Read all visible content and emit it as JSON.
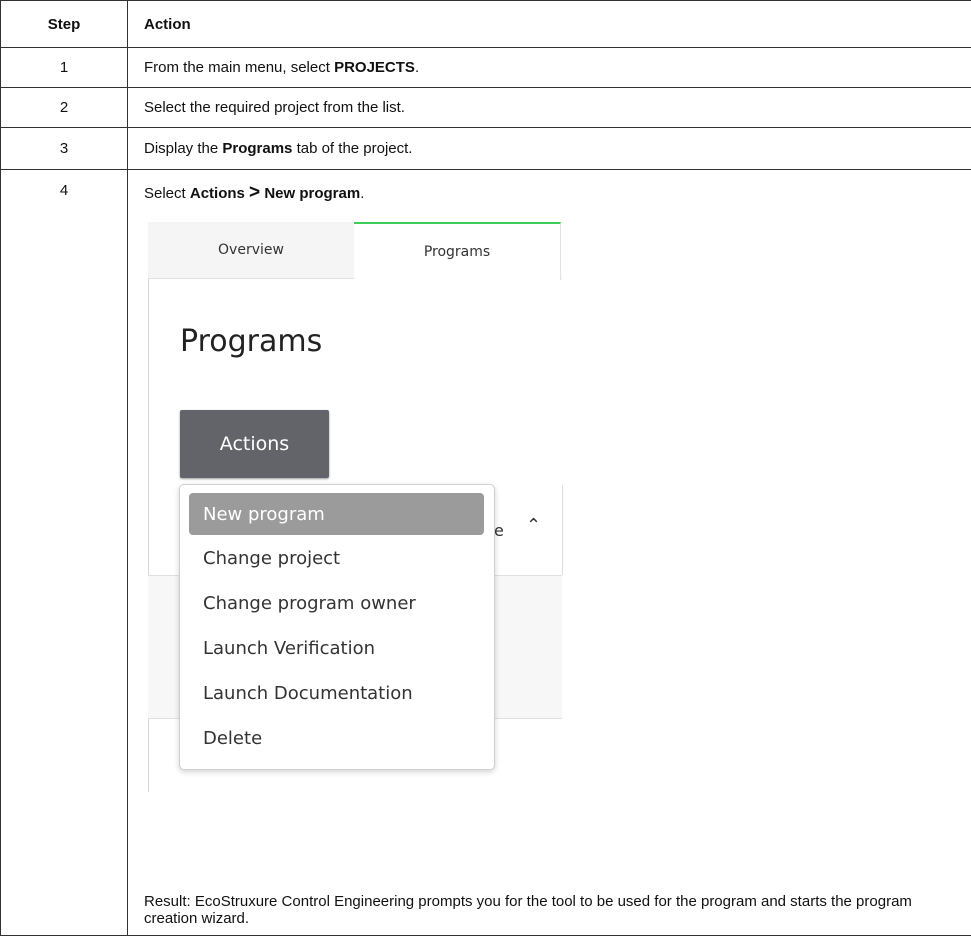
{
  "table": {
    "headers": {
      "step": "Step",
      "action": "Action"
    },
    "rows": [
      {
        "step": "1",
        "pre": "From the main menu, select ",
        "bold": "PROJECTS",
        "post": "."
      },
      {
        "step": "2",
        "text": "Select the required project from the list."
      },
      {
        "step": "3",
        "pre": "Display the ",
        "bold": "Programs",
        "post": " tab of the project."
      },
      {
        "step": "4",
        "pre": "Select ",
        "bold1": "Actions",
        "sep": ">",
        "bold2": "New program",
        "post": "."
      }
    ]
  },
  "screenshot": {
    "tabs": [
      "Overview",
      "Programs"
    ],
    "page_title": "Programs",
    "actions_button": "Actions",
    "sort_fragment": "e",
    "chevron": "^",
    "menu_items": [
      "New program",
      "Change project",
      "Change program owner",
      "Launch Verification",
      "Launch Documentation",
      "Delete"
    ],
    "selected_item": "New program",
    "colors": {
      "active_tab": "#3dcd58",
      "actions_button": "#626469",
      "selected_item": "#9b9b9b"
    }
  },
  "result": "Result: EcoStruxure Control Engineering prompts you for the tool to be used for the program and starts the program creation wizard."
}
